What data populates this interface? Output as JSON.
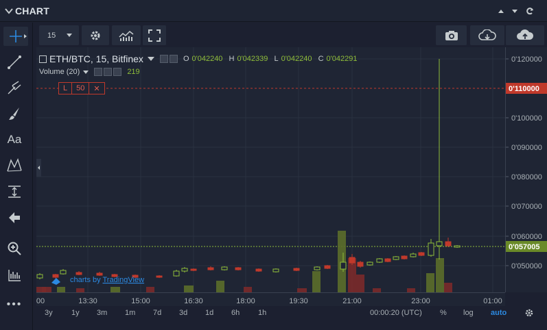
{
  "header": {
    "title": "CHART"
  },
  "toolbar": {
    "interval": "15"
  },
  "legend": {
    "symbol": "ETH/BTC, 15, Bitfinex",
    "open_label": "O",
    "open": "0'042240",
    "high_label": "H",
    "high": "0'042339",
    "low_label": "L",
    "low": "0'042240",
    "close_label": "C",
    "close": "0'042291",
    "volume_label": "Volume (20)",
    "volume_value": "219"
  },
  "order_line": {
    "side": "L",
    "amount": "50",
    "close": "✕"
  },
  "price_axis": {
    "ticks": [
      "0'120000",
      "0'100000",
      "0'090000",
      "0'080000",
      "0'070000",
      "0'060000",
      "0'050000"
    ],
    "order_price": "0'110000",
    "last_price": "0'057005"
  },
  "time_axis": {
    "ticks": [
      "00",
      "13:30",
      "15:00",
      "16:30",
      "18:00",
      "19:30",
      "21:00",
      "23:00",
      "01:00"
    ]
  },
  "ranges": [
    "3y",
    "1y",
    "3m",
    "1m",
    "7d",
    "3d",
    "1d",
    "6h",
    "1h"
  ],
  "status": {
    "clock": "00:00:20 (UTC)",
    "percent": "%",
    "log": "log",
    "auto": "auto"
  },
  "watermark": {
    "prefix": "charts by",
    "brand": "TradingView"
  },
  "colors": {
    "up": "#8fbd3a",
    "down": "#c0392b",
    "accent": "#2c8ae2"
  }
}
